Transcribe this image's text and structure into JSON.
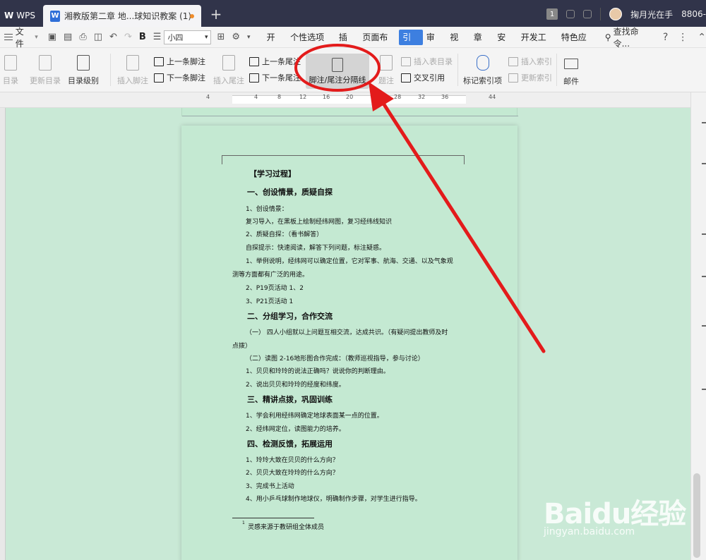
{
  "titlebar": {
    "app_name": "WPS",
    "doc_tab_title": "湘教版第二章  地...球知识教案 (1)",
    "new_tab": "+",
    "badge": "1",
    "user_name": "掬月光在手",
    "user_id": "8806-"
  },
  "menubar": {
    "file_label": "文件",
    "font_size": "小四",
    "tabs": [
      "开始",
      "个性选项卡",
      "插入",
      "页面布局",
      "引用",
      "审阅",
      "视图",
      "章节",
      "安全",
      "开发工具",
      "特色应用"
    ],
    "active_tab": "引用",
    "search_label": "查找命令..."
  },
  "ribbon": {
    "toc": "目录",
    "update_toc": "更新目录",
    "toc_level": "目录级别",
    "insert_footnote": "插入脚注",
    "prev_footnote": "上一条脚注",
    "next_footnote": "下一条脚注",
    "insert_endnote": "插入尾注",
    "prev_endnote": "上一条尾注",
    "next_endnote": "下一条尾注",
    "separator": "脚注/尾注分隔线",
    "caption": "题注",
    "insert_table_toc": "插入表目录",
    "cross_ref": "交叉引用",
    "mark_index": "标记索引项",
    "insert_index": "插入索引",
    "update_index": "更新索引",
    "mail": "邮件"
  },
  "ruler": [
    "4",
    "4",
    "8",
    "12",
    "16",
    "20",
    "28",
    "32",
    "36",
    "44"
  ],
  "document": {
    "title": "【学习过程】",
    "sections": [
      {
        "heading": "一、创设情景，质疑自探",
        "lines": [
          "1、创设情景：",
          "复习导入，在黑板上绘制经纬网图，复习经纬线知识",
          "2、质疑自探：（看书解答）",
          "自探提示：快速阅读，解答下列问题，标注疑惑。",
          "1、举例说明，经纬网可以确定位置，它对军事、航海、交通、以及气象观",
          "测等方面都有广泛的用途。",
          "2、P19页活动 1、2",
          "3、P21页活动 1"
        ]
      },
      {
        "heading": "二、分组学习，合作交流",
        "lines": [
          "（一）  四人小组就以上问题互相交流，达成共识。（有疑问提出教师及时",
          "点拨）",
          "（二）读图 2-16地形图合作完成：（教师巡视指导，参与讨论）",
          "1、贝贝和玲玲的说法正确吗？说说你的判断理由。",
          "2、说出贝贝和玲玲的经度和纬度。"
        ]
      },
      {
        "heading": "三、精讲点拨，巩固训练",
        "lines": [
          "1、学会利用经纬网确定地球表面某一点的位置。",
          "2、经纬网定位，读图能力的培养。"
        ]
      },
      {
        "heading": "四、检测反馈，拓展运用",
        "lines": [
          "1、玲玲大致在贝贝的什么方向？",
          "2、贝贝大致在玲玲的什么方向？",
          "3、完成书上活动",
          "4、用小乒乓球制作地球仪，明确制作步骤，对学生进行指导。"
        ]
      }
    ],
    "footnote_mark": "1",
    "footnote": "灵感来源于教研组全体成员"
  },
  "watermark": {
    "title": "Baidu经验",
    "sub": "jingyan.baidu.com"
  },
  "colors": {
    "titlebar_bg": "#31344a",
    "active_tab": "#3d7fe0",
    "page_bg": "#c4e9d2",
    "annotation": "#e31b1b"
  }
}
